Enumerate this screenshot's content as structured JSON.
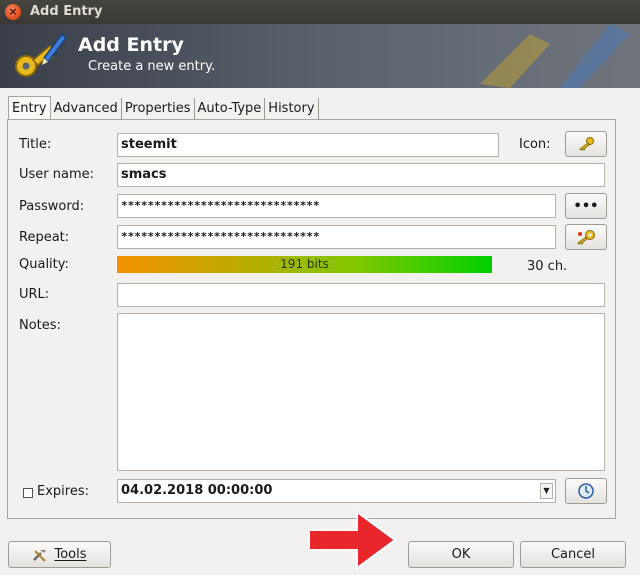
{
  "window": {
    "title": "Add Entry"
  },
  "banner": {
    "title": "Add Entry",
    "subtitle": "Create a new entry."
  },
  "tabs": [
    "Entry",
    "Advanced",
    "Properties",
    "Auto-Type",
    "History"
  ],
  "form": {
    "title_label": "Title:",
    "title_value": "steemit",
    "icon_label": "Icon:",
    "username_label": "User name:",
    "username_value": "smacs",
    "password_label": "Password:",
    "password_value": "******************************",
    "repeat_label": "Repeat:",
    "repeat_value": "******************************",
    "show_password_label": "•••",
    "quality_label": "Quality:",
    "quality_text": "191 bits",
    "quality_chars": "30 ch.",
    "url_label": "URL:",
    "url_value": "",
    "notes_label": "Notes:",
    "notes_value": "",
    "expires_label": "Expires:",
    "expires_value": "04.02.2018 00:00:00"
  },
  "footer": {
    "tools_label": "Tools",
    "ok_label": "OK",
    "cancel_label": "Cancel"
  },
  "colors": {
    "arrow": "#e8262b",
    "banner": "#5d6470"
  }
}
